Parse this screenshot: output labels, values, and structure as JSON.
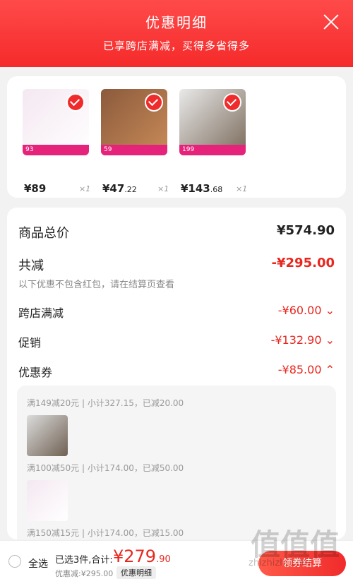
{
  "header": {
    "title": "优惠明细",
    "subtitle": "已享跨店满减，买得多省得多"
  },
  "products": [
    {
      "price_main": "¥89",
      "price_decimals": "",
      "qty": "×1",
      "badge": "93"
    },
    {
      "price_main": "¥47",
      "price_decimals": ".22",
      "qty": "×1",
      "badge": "59"
    },
    {
      "price_main": "¥143",
      "price_decimals": ".68",
      "qty": "×1",
      "badge": "199"
    }
  ],
  "summary": {
    "total_label": "商品总价",
    "total_value": "¥574.90",
    "reduce_label": "共减",
    "reduce_value": "-¥295.00",
    "note": "以下优惠不包含红包，请在结算页查看",
    "items": [
      {
        "label": "跨店满减",
        "value": "-¥60.00",
        "chevron": "⌄"
      },
      {
        "label": "促销",
        "value": "-¥132.90",
        "chevron": "⌄"
      },
      {
        "label": "优惠券",
        "value": "-¥85.00",
        "chevron": "⌃"
      }
    ],
    "coupon_lines": [
      "满149减20元 | 小计327.15，已减20.00",
      "满100减50元 | 小计174.00，已减50.00",
      "满150减15元 | 小计174.00，已减15.00"
    ]
  },
  "footer": {
    "select_all": "全选",
    "selected_text": "已选3件,合计:",
    "total_main": "¥279",
    "total_decimals": ".90",
    "discount_text": "优惠减:¥295.00",
    "detail_button": "优惠明细",
    "checkout_button": "领券结算"
  },
  "watermark": {
    "big": "值值值",
    "site": "zhizhizhi.com"
  },
  "colors": {
    "accent": "#f02b2b",
    "discount_red": "#e8271f"
  }
}
